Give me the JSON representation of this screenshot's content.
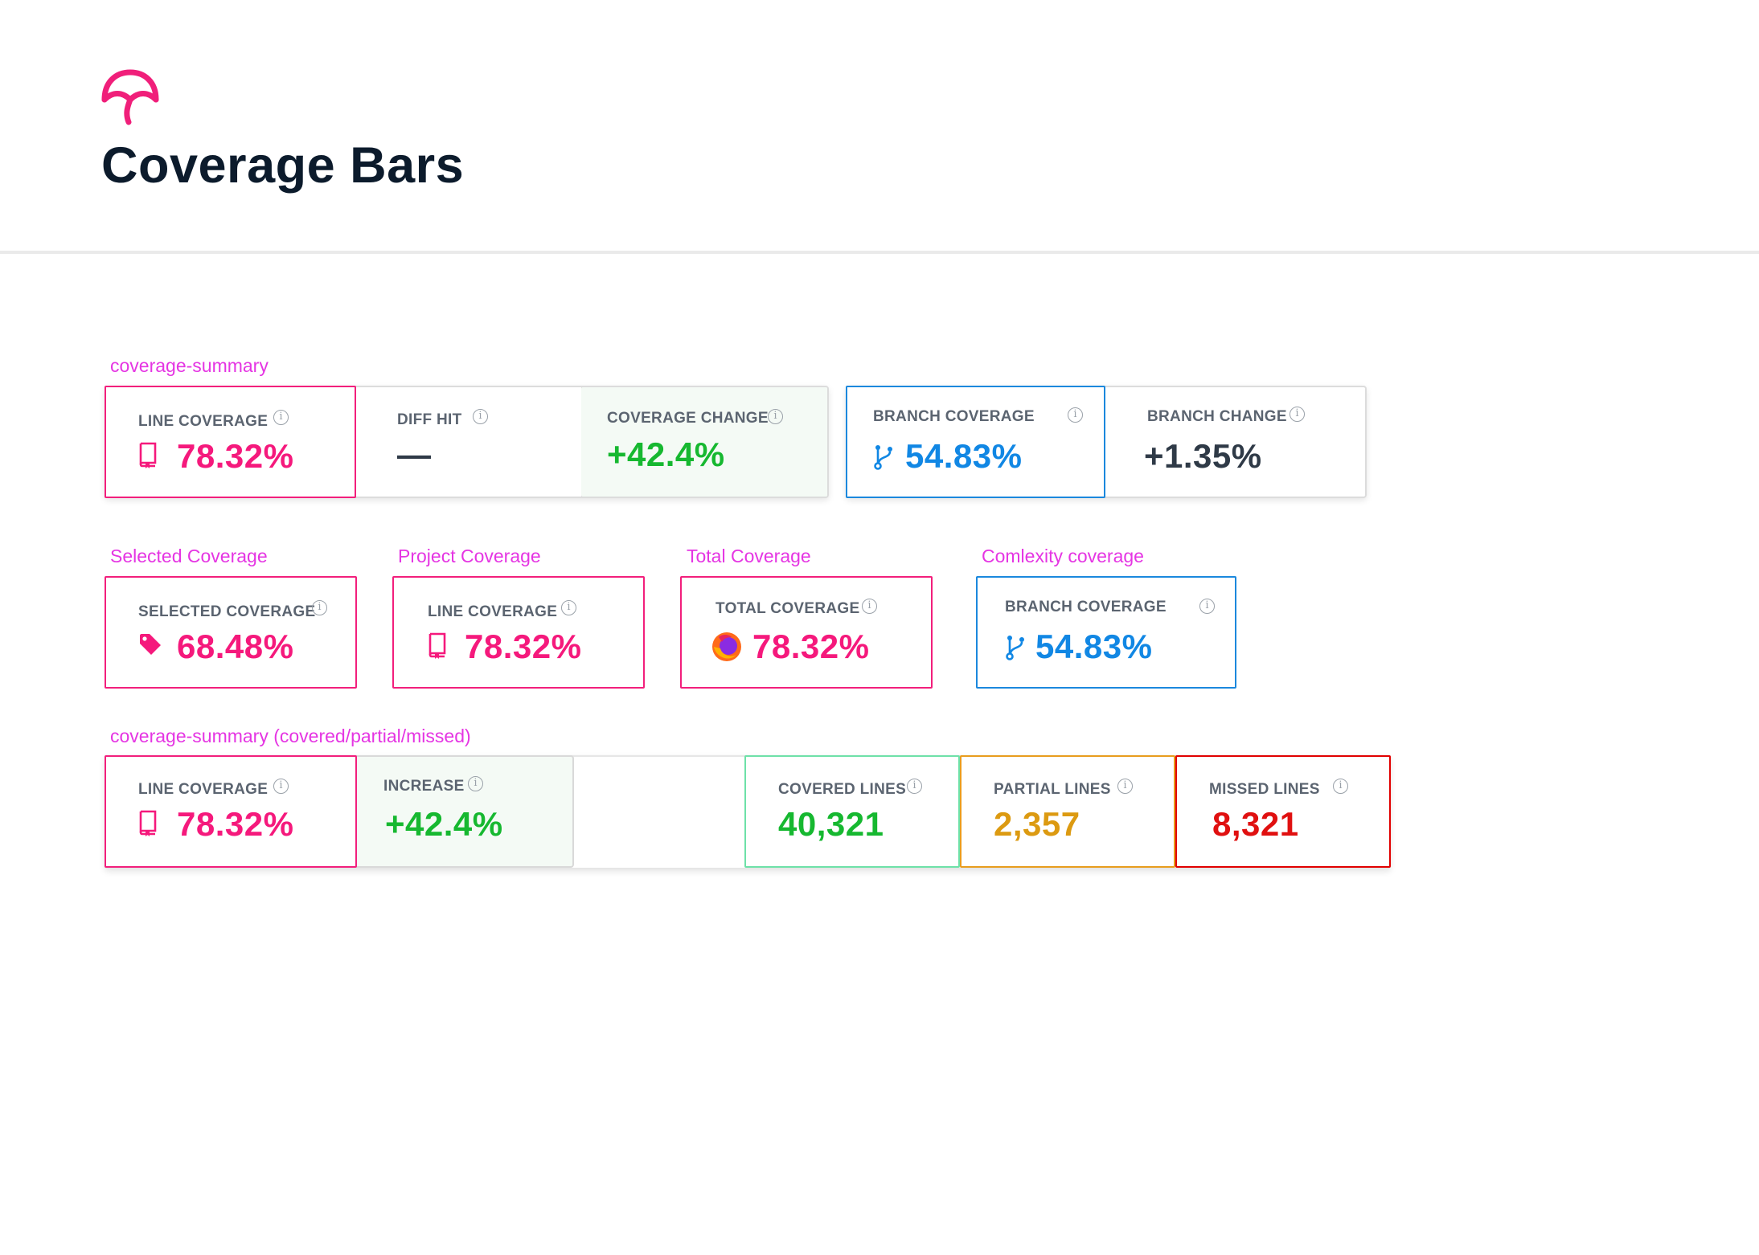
{
  "page": {
    "title": "Coverage Bars",
    "brand_color": "#F01F7A",
    "logo_icon": "umbrella-logo-icon"
  },
  "colors": {
    "pink": "#F5197C",
    "blue": "#1187E4",
    "green": "#16B830",
    "dark": "#2F3A47",
    "orange": "#DC9A11",
    "red": "#E01010",
    "section_label": "#E535E3"
  },
  "sections": {
    "summary": {
      "label": "coverage-summary",
      "line_coverage": {
        "label": "LINE COVERAGE",
        "value": "78.32%",
        "icon": "book-icon"
      },
      "diff_hit": {
        "label": "DIFF HIT",
        "value": "—"
      },
      "coverage_change": {
        "label": "COVERAGE CHANGE",
        "value": "+42.4%"
      },
      "branch_coverage": {
        "label": "BRANCH COVERAGE",
        "value": "54.83%",
        "icon": "branch-icon"
      },
      "branch_change": {
        "label": "BRANCH CHANGE",
        "value": "+1.35%"
      }
    },
    "selected": {
      "label": "Selected Coverage",
      "card": {
        "label": "SELECTED COVERAGE",
        "value": "68.48%",
        "icon": "tag-icon"
      }
    },
    "project": {
      "label": "Project Coverage",
      "card": {
        "label": "LINE COVERAGE",
        "value": "78.32%",
        "icon": "book-icon"
      }
    },
    "total": {
      "label": "Total Coverage",
      "card": {
        "label": "TOTAL COVERAGE",
        "value": "78.32%",
        "icon": "firefox-icon"
      }
    },
    "complexity": {
      "label": "Comlexity coverage",
      "card": {
        "label": "BRANCH COVERAGE",
        "value": "54.83%",
        "icon": "branch-icon"
      }
    },
    "lines": {
      "label": "coverage-summary (covered/partial/missed)",
      "line_coverage": {
        "label": "LINE COVERAGE",
        "value": "78.32%",
        "icon": "book-icon"
      },
      "increase": {
        "label": "INCREASE",
        "value": "+42.4%"
      },
      "covered": {
        "label": "COVERED LINES",
        "value": "40,321"
      },
      "partial": {
        "label": "PARTIAL LINES",
        "value": "2,357"
      },
      "missed": {
        "label": "MISSED LINES",
        "value": "8,321"
      }
    }
  },
  "info_glyph": "i"
}
